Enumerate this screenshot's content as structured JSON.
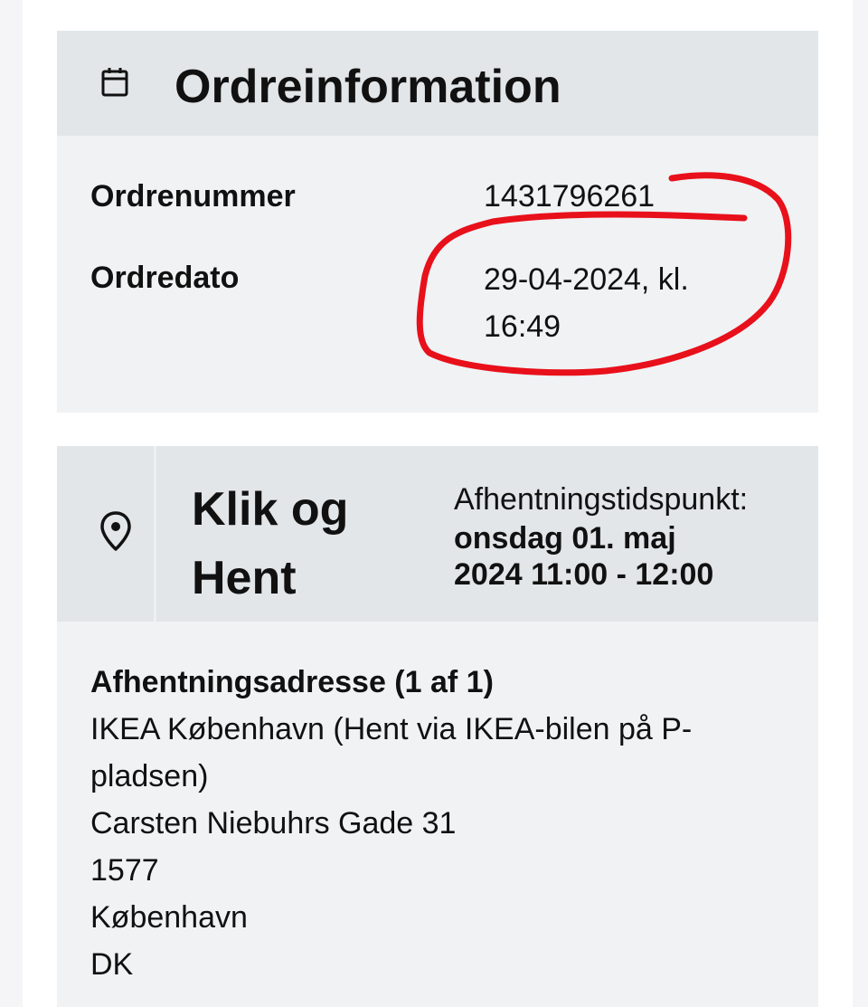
{
  "order_info": {
    "title": "Ordreinformation",
    "icon": "calendar-icon",
    "order_number_label": "Ordrenummer",
    "order_number": "1431796261",
    "order_date_label": "Ordredato",
    "order_date_line1": "29-04-2024, kl.",
    "order_date_line2": "16:49",
    "annotation_color": "#e8101a"
  },
  "pickup": {
    "icon": "location-pin-icon",
    "title_line1": "Klik og",
    "title_line2": "Hent",
    "time_label": "Afhentningstidspunkt:",
    "time_line1": "onsdag 01. maj",
    "time_line2": "2024 11:00 - 12:00",
    "address_heading": "Afhentningsadresse (1 af 1)",
    "address_lines": [
      "IKEA København (Hent via IKEA-bilen på P-",
      "pladsen)",
      "Carsten Niebuhrs Gade 31",
      "1577",
      "København",
      "DK"
    ]
  }
}
